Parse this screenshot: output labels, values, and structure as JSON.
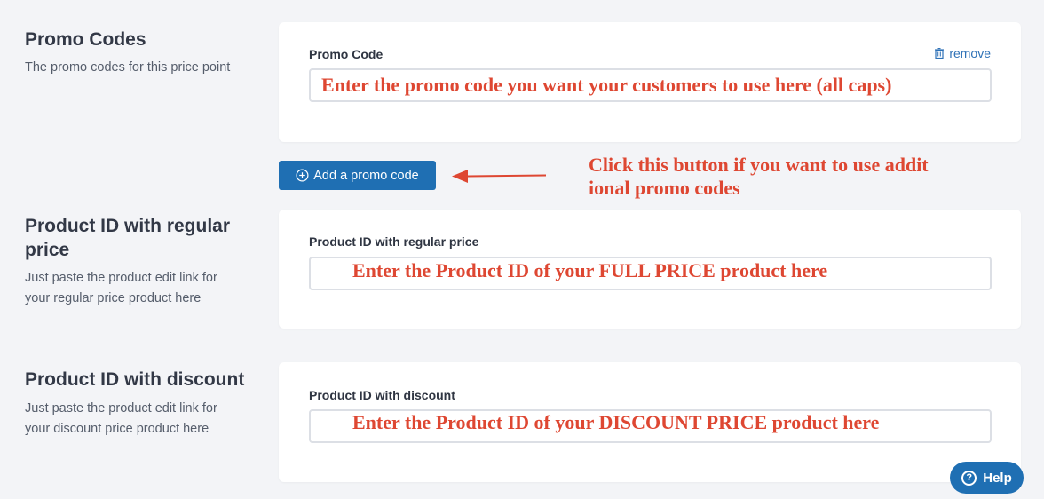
{
  "promo_section": {
    "title": "Promo Codes",
    "description": "The promo codes for this price point",
    "field_label": "Promo Code",
    "remove_label": "remove",
    "input_value": "",
    "annotation": "Enter the promo code you want your customers to use here (all caps)"
  },
  "add_button": {
    "label": "Add a promo code",
    "annotation_line1": "Click this button if you want to use addit",
    "annotation_line2": "ional promo codes"
  },
  "regular_section": {
    "title_line1": "Product ID with regular",
    "title_line2": "price",
    "description_line1": "Just paste the product edit link for",
    "description_line2": "your regular price product here",
    "field_label": "Product ID with regular price",
    "input_value": "",
    "annotation": "Enter the Product ID of your FULL PRICE product here"
  },
  "discount_section": {
    "title": "Product ID with discount",
    "description_line1": "Just paste the product edit link for",
    "description_line2": "your discount price product here",
    "field_label": "Product ID with discount",
    "input_value": "",
    "annotation": "Enter the Product ID of your DISCOUNT PRICE product here"
  },
  "help_button": {
    "label": "Help",
    "icon": "question-circle-icon"
  },
  "colors": {
    "accent": "#1f6fb3",
    "annotation": "#de4732",
    "background": "#f3f4f7"
  }
}
